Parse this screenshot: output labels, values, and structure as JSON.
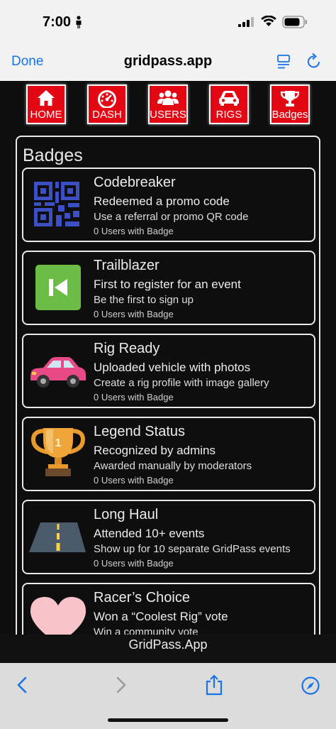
{
  "status_bar": {
    "time": "7:00"
  },
  "browser": {
    "done_label": "Done",
    "title": "gridpass.app"
  },
  "nav": {
    "items": [
      {
        "label": "HOME",
        "icon": "home-icon"
      },
      {
        "label": "DASH",
        "icon": "gauge-icon"
      },
      {
        "label": "USERS",
        "icon": "users-icon"
      },
      {
        "label": "RIGS",
        "icon": "car-icon"
      },
      {
        "label": "Badges",
        "icon": "trophy-icon"
      }
    ]
  },
  "badges_panel": {
    "title": "Badges",
    "items": [
      {
        "name": "Codebreaker",
        "description": "Redeemed a promo code",
        "hint": "Use a referral or promo QR code",
        "count": "0 Users with Badge",
        "icon": "qr-code-icon"
      },
      {
        "name": "Trailblazer",
        "description": "First to register for an event",
        "hint": "Be the first to sign up",
        "count": "0 Users with Badge",
        "icon": "skip-back-icon"
      },
      {
        "name": "Rig Ready",
        "description": "Uploaded vehicle with photos",
        "hint": "Create a rig profile with image gallery",
        "count": "0 Users with Badge",
        "icon": "pink-car-icon"
      },
      {
        "name": "Legend Status",
        "description": "Recognized by admins",
        "hint": "Awarded manually by moderators",
        "count": "0 Users with Badge",
        "icon": "trophy-icon"
      },
      {
        "name": "Long Haul",
        "description": "Attended 10+ events",
        "hint": "Show up for 10 separate GridPass events",
        "count": "0 Users with Badge",
        "icon": "road-icon"
      },
      {
        "name": "Racer’s Choice",
        "description": "Won a “Coolest Rig” vote",
        "hint": "Win a community vote",
        "count": "",
        "icon": "heart-icon"
      }
    ]
  },
  "footer": {
    "text": "GridPass.App"
  },
  "colors": {
    "accent_red": "#e30613",
    "link_blue": "#1a73e8",
    "page_bg": "#0e0e0e"
  }
}
